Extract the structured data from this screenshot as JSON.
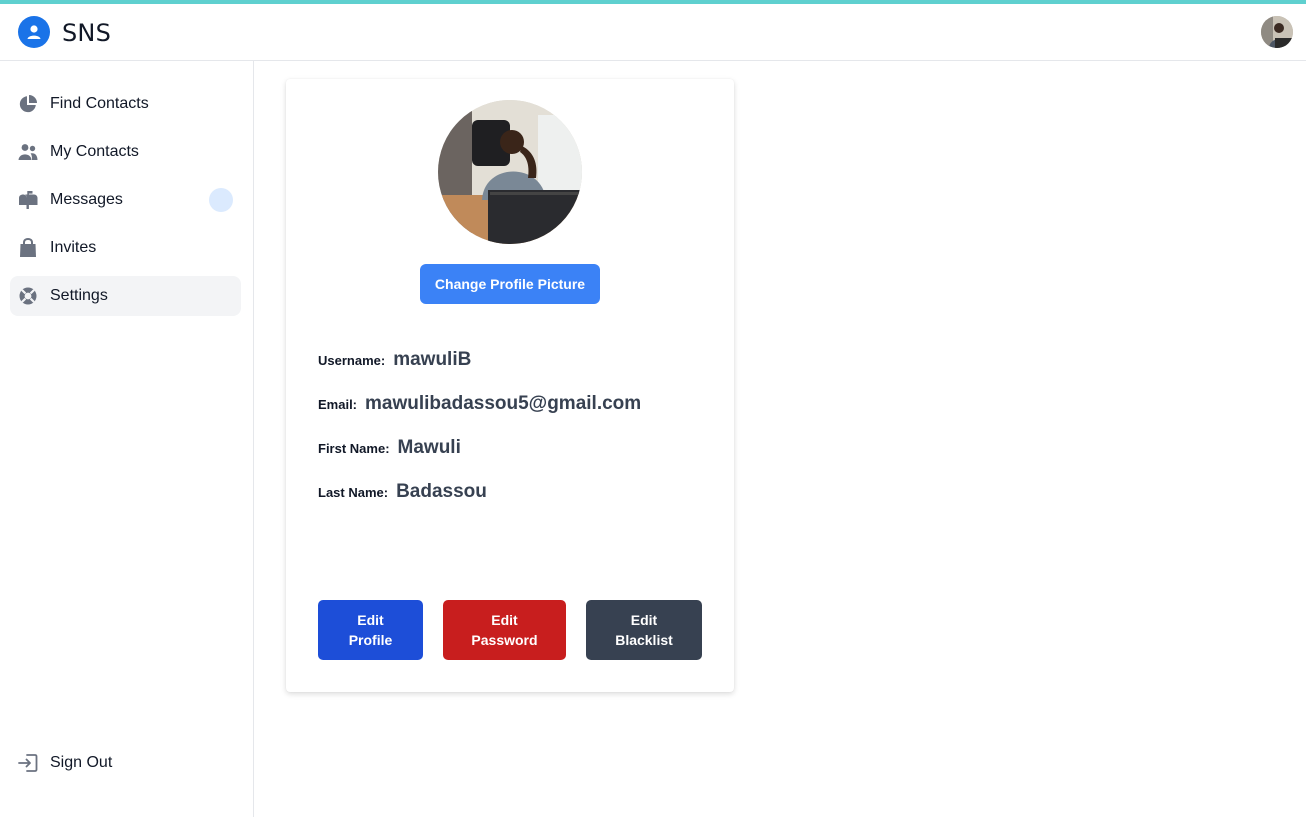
{
  "app": {
    "name": "SNS"
  },
  "sidebar": {
    "items": [
      {
        "label": "Find Contacts",
        "icon": "pie-chart-icon"
      },
      {
        "label": "My Contacts",
        "icon": "users-icon"
      },
      {
        "label": "Messages",
        "icon": "mailbox-icon"
      },
      {
        "label": "Invites",
        "icon": "shopping-bag-icon"
      },
      {
        "label": "Settings",
        "icon": "support-icon",
        "active": true
      }
    ],
    "sign_out": {
      "label": "Sign Out",
      "icon": "sign-out-icon"
    }
  },
  "profile": {
    "change_picture_label": "Change Profile Picture",
    "fields": [
      {
        "label": "Username:",
        "value": "mawuliB"
      },
      {
        "label": "Email:",
        "value": "mawulibadassou5@gmail.com"
      },
      {
        "label": "First Name:",
        "value": "Mawuli"
      },
      {
        "label": "Last Name:",
        "value": "Badassou"
      }
    ],
    "buttons": {
      "edit_profile": [
        "Edit",
        "Profile"
      ],
      "edit_password": [
        "Edit",
        "Password"
      ],
      "edit_blacklist": [
        "Edit",
        "Blacklist"
      ]
    }
  },
  "colors": {
    "brand": "#1a73e8",
    "primary_button": "#3b82f6",
    "edit_profile": "#1d4ed8",
    "edit_password": "#c81e1e",
    "edit_blacklist": "#374151",
    "top_stripe": "#5fd0cf"
  }
}
